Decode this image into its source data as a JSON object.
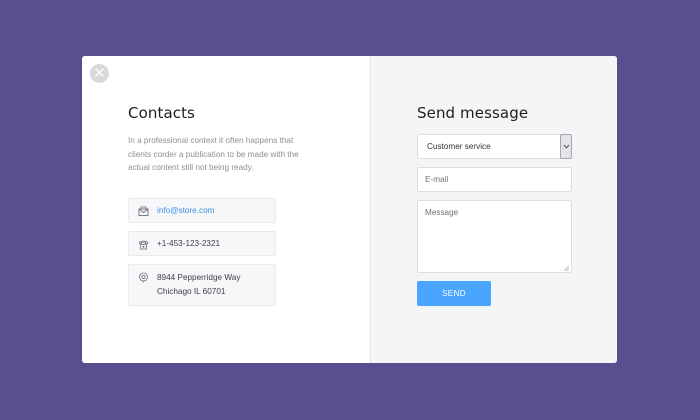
{
  "colors": {
    "background": "#584f8f",
    "accent": "#4aa5ff",
    "link": "#3a8ee6"
  },
  "close": {
    "icon": "close-icon"
  },
  "contacts": {
    "title": "Contacts",
    "description": "In a professional context it often happens that clients corder a publication to be made with the actual content still not being ready.",
    "email": {
      "icon": "mail-icon",
      "value": "info@store.com"
    },
    "phone": {
      "icon": "phone-icon",
      "value": "+1-453-123-2321"
    },
    "address": {
      "icon": "location-icon",
      "line1": "8944 Pepperridge Way",
      "line2": "Chichago IL 60701"
    }
  },
  "message_form": {
    "title": "Send message",
    "department": {
      "selected": "Customer service",
      "icon": "chevron-down-icon"
    },
    "email_placeholder": "E-mail",
    "message_placeholder": "Message",
    "send_label": "SEND"
  }
}
